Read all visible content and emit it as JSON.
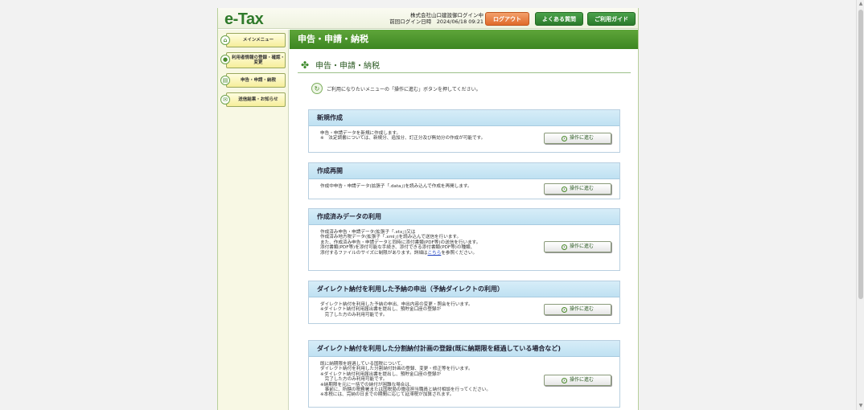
{
  "header": {
    "logo": "e-Tax",
    "company": "株式会社山口建設御ログイン中",
    "last_login": "前回ログイン日時　2024/06/18 09:21",
    "logout_label": "ログアウト",
    "faq_label": "よくある質問",
    "guide_label": "ご利用ガイド"
  },
  "sidebar": {
    "items": [
      {
        "label": "メインメニュー"
      },
      {
        "label": "利用者情報の登録・確認・変更"
      },
      {
        "label": "申告・申請・納税"
      },
      {
        "label": "送信結果・お知らせ"
      }
    ]
  },
  "main": {
    "bar_title": "申告・申請・納税",
    "section_title": "申告・申請・納税",
    "notice": "ご利用になりたいメニューの「操作に進む」ボタンを押してください。",
    "go_label": "操作に進む",
    "cards": [
      {
        "title": "新規作成",
        "lines": [
          "申告・申請データを新規に作成します。",
          "※　法定調書については、新規分、追加分、訂正分及び無効分の作成が可能です。"
        ]
      },
      {
        "title": "作成再開",
        "lines": [
          "作成中申告・申請データ(拡張子「.data」)を読み込んで作成を再開します。"
        ]
      },
      {
        "title": "作成済みデータの利用",
        "lines": [
          "作成済み申告・申請データ(拡張子「.xtx」)又は",
          "作成済み地方税データ(拡張子「.xml」)を読み込んで送信を行います。",
          "また、作成済み申告・申請データと同時に添付書類(PDF等)の送信を行います。",
          "添付書類(PDF等)を添付可能な手続き、添付できる添付書類(PDF等)の種類、",
          "添付するファイルのサイズに制限があります。詳細は"
        ],
        "link_text": "こちら",
        "link_suffix": "を参照ください。"
      },
      {
        "title": "ダイレクト納付を利用した予納の申出（予納ダイレクトの利用）",
        "lines": [
          "ダイレクト納付を利用した予納の申出、申出内容の変更・照会を行います。",
          "※ダイレクト納付利用届出書を提出し、預貯金口座の登録が",
          "　完了した方のみ利用可能です。"
        ]
      },
      {
        "title": "ダイレクト納付を利用した分割納付計画の登録(既に納期限を経過している場合など)",
        "lines": [
          "既に納期限を経過している国税について、",
          "ダイレクト納付を利用した分割納付計画の登録、変更・修正等を行います。",
          "※ダイレクト納付利用届出書を提出し、預貯金口座の登録が",
          "　完了した方のみ利用可能です。",
          "※納期限を元に一括での納付が困難な場合は、",
          "　事前に、所轄の税務署または国税局の徴収担当職員と納付相談を行ってください。",
          "※本税には、完納の日までの期間に応じて延滞税が加算されます。"
        ]
      }
    ]
  }
}
